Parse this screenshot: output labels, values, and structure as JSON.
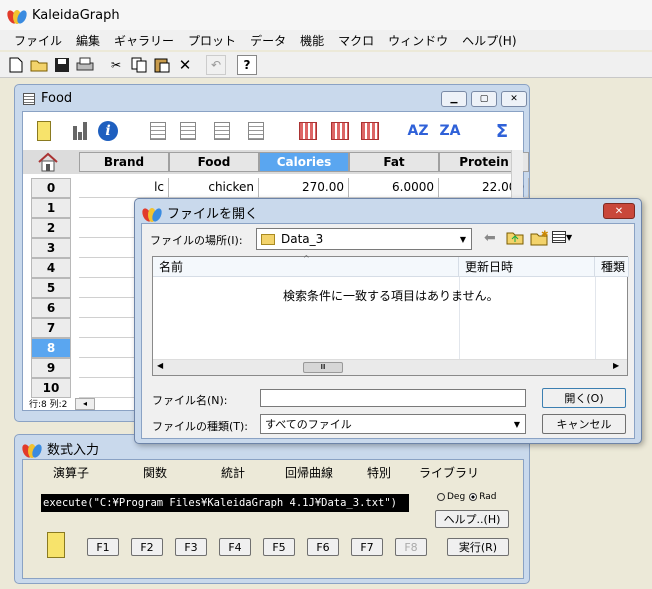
{
  "app": {
    "title": "KaleidaGraph",
    "menu": [
      "ファイル",
      "編集",
      "ギャラリー",
      "プロット",
      "データ",
      "機能",
      "マクロ",
      "ウィンドウ",
      "ヘルプ(H)"
    ]
  },
  "toolbar": {
    "icons": [
      "new-file-icon",
      "open-folder-icon",
      "save-icon",
      "print-icon",
      "cut-icon",
      "copy-icon",
      "paste-icon",
      "delete-icon",
      "undo-icon",
      "help-icon"
    ],
    "help_label": "?"
  },
  "data_window": {
    "title": "Food",
    "status": "行:8  列:2",
    "columns": [
      "Brand",
      "Food",
      "Calories",
      "Fat",
      "Protein"
    ],
    "selected_column": "Calories",
    "rows": [
      "0",
      "1",
      "2",
      "3",
      "4",
      "5",
      "6",
      "7",
      "8",
      "9",
      "10"
    ],
    "selected_row": "8",
    "row0": [
      "lc",
      "chicken",
      "270.00",
      "6.0000",
      "22.000"
    ]
  },
  "formula_window": {
    "title": "数式入力",
    "menu": [
      "演算子",
      "関数",
      "統計",
      "回帰曲線",
      "特別",
      "ライブラリ"
    ],
    "formula": "execute(\"C:¥Program Files¥KaleidaGraph 4.1J¥Data_3.txt\")",
    "deg_label": "Deg",
    "rad_label": "Rad",
    "angle_mode": "Rad",
    "help_button": "ヘルプ..(H)",
    "run_button": "実行(R)",
    "function_keys": [
      "F1",
      "F2",
      "F3",
      "F4",
      "F5",
      "F6",
      "F7",
      "F8"
    ]
  },
  "open_dialog": {
    "title": "ファイルを開く",
    "location_label": "ファイルの場所(I):",
    "location_value": "Data_3",
    "list_headers": [
      "名前",
      "更新日時",
      "種類"
    ],
    "empty_message": "検索条件に一致する項目はありません。",
    "filename_label": "ファイル名(N):",
    "filename_value": "",
    "filetype_label": "ファイルの種類(T):",
    "filetype_value": "すべてのファイル",
    "open_button": "開く(O)",
    "cancel_button": "キャンセル"
  }
}
